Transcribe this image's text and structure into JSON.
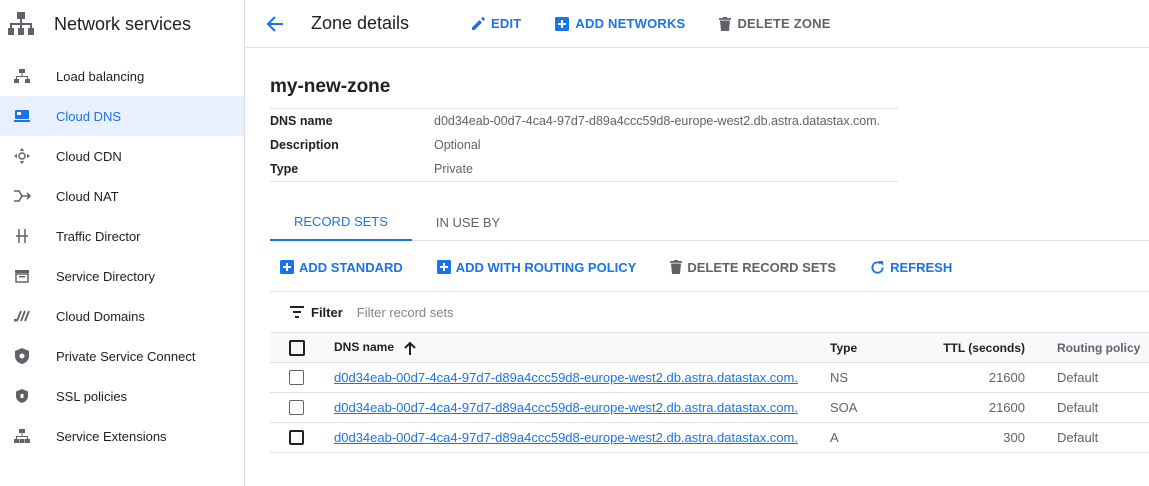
{
  "sidebar": {
    "title": "Network services",
    "items": [
      {
        "label": "Load balancing",
        "icon": "load-balancing-icon"
      },
      {
        "label": "Cloud DNS",
        "icon": "cloud-dns-icon",
        "active": true
      },
      {
        "label": "Cloud CDN",
        "icon": "cloud-cdn-icon"
      },
      {
        "label": "Cloud NAT",
        "icon": "cloud-nat-icon"
      },
      {
        "label": "Traffic Director",
        "icon": "traffic-director-icon"
      },
      {
        "label": "Service Directory",
        "icon": "service-directory-icon"
      },
      {
        "label": "Cloud Domains",
        "icon": "cloud-domains-icon"
      },
      {
        "label": "Private Service Connect",
        "icon": "shield-icon"
      },
      {
        "label": "SSL policies",
        "icon": "ssl-shield-icon"
      },
      {
        "label": "Service Extensions",
        "icon": "service-extensions-icon"
      }
    ]
  },
  "header": {
    "title": "Zone details",
    "edit": "EDIT",
    "add_networks": "ADD NETWORKS",
    "delete_zone": "DELETE ZONE"
  },
  "zone": {
    "name": "my-new-zone",
    "details": [
      {
        "key": "DNS name",
        "value": "d0d34eab-00d7-4ca4-97d7-d89a4ccc59d8-europe-west2.db.astra.datastax.com."
      },
      {
        "key": "Description",
        "value": "Optional"
      },
      {
        "key": "Type",
        "value": "Private"
      }
    ]
  },
  "tabs": [
    {
      "label": "RECORD SETS",
      "active": true
    },
    {
      "label": "IN USE BY"
    }
  ],
  "actions": {
    "add_standard": "ADD STANDARD",
    "add_routing": "ADD WITH ROUTING POLICY",
    "delete_records": "DELETE RECORD SETS",
    "refresh": "REFRESH"
  },
  "filter": {
    "label": "Filter",
    "placeholder": "Filter record sets"
  },
  "table": {
    "columns": {
      "name": "DNS name",
      "type": "Type",
      "ttl": "TTL (seconds)",
      "policy": "Routing policy"
    },
    "rows": [
      {
        "name": "d0d34eab-00d7-4ca4-97d7-d89a4ccc59d8-europe-west2.db.astra.datastax.com.",
        "type": "NS",
        "ttl": "21600",
        "policy": "Default"
      },
      {
        "name": "d0d34eab-00d7-4ca4-97d7-d89a4ccc59d8-europe-west2.db.astra.datastax.com.",
        "type": "SOA",
        "ttl": "21600",
        "policy": "Default"
      },
      {
        "name": "d0d34eab-00d7-4ca4-97d7-d89a4ccc59d8-europe-west2.db.astra.datastax.com.",
        "type": "A",
        "ttl": "300",
        "policy": "Default"
      }
    ]
  },
  "colors": {
    "accent": "#1a73e8",
    "active_bg": "#e8f0fe",
    "muted": "#5f6368"
  }
}
